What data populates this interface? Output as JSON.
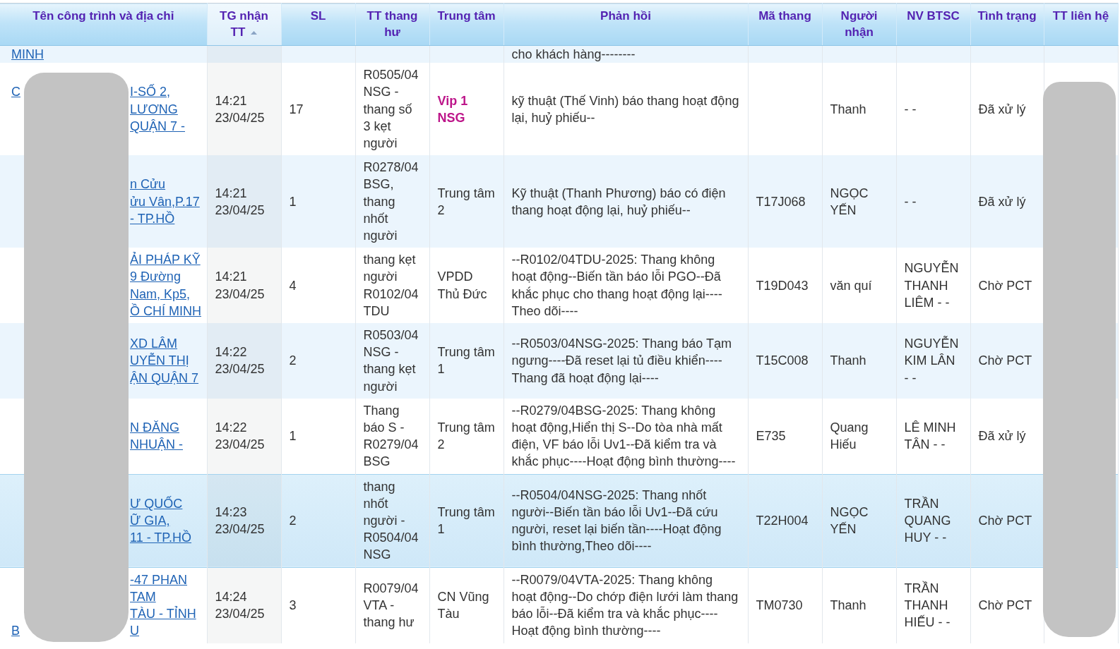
{
  "table": {
    "columns": [
      {
        "label": "Tên công trình và địa chỉ",
        "sorted": false
      },
      {
        "label": "TG nhận TT",
        "sorted": true
      },
      {
        "label": "SL",
        "sorted": false
      },
      {
        "label": "TT thang hư",
        "sorted": false
      },
      {
        "label": "Trung tâm",
        "sorted": false
      },
      {
        "label": "Phản hồi",
        "sorted": false
      },
      {
        "label": "Mã thang",
        "sorted": false
      },
      {
        "label": "Người nhận",
        "sorted": false
      },
      {
        "label": "NV BTSC",
        "sorted": false
      },
      {
        "label": "Tình trạng",
        "sorted": false
      },
      {
        "label": "TT liên hệ",
        "sorted": false
      }
    ],
    "rows": [
      {
        "clipped": true,
        "selected": false,
        "address": [
          {
            "start": "MINH"
          }
        ],
        "feedback": "cho khách hàng--------"
      },
      {
        "clipped": false,
        "selected": false,
        "address": [
          {
            "start": "C",
            "end": "I-SỐ 2,"
          },
          {
            "end": "LƯƠNG"
          },
          {
            "end": "QUẬN 7 -"
          }
        ],
        "time": "14:21 23/04/25",
        "quantity": "17",
        "fault": "R0505/04 NSG - thang số 3 kẹt người",
        "center": {
          "text": "Vip 1 NSG",
          "emphasized": true
        },
        "feedback": "kỹ thuật (Thế Vinh) báo thang hoạt động lại, huỷ phiếu--",
        "receiver": "Thanh",
        "staff": "- -",
        "status": "Đã xử lý"
      },
      {
        "clipped": false,
        "selected": false,
        "address": [
          {
            "end": "n Cửu"
          },
          {
            "end": "ửu Vân,P.17"
          },
          {
            "end": "- TP.HỒ"
          }
        ],
        "time": "14:21 23/04/25",
        "quantity": "1",
        "fault": "R0278/04 BSG, thang nhốt người",
        "center": {
          "text": "Trung tâm 2",
          "emphasized": false
        },
        "feedback": "Kỹ thuật (Thanh Phương) báo có điện thang hoạt động lại, huỷ phiếu--",
        "code": "T17J068",
        "receiver": "NGỌC YẾN",
        "staff": "- -",
        "status": "Đã xử lý"
      },
      {
        "clipped": false,
        "selected": false,
        "address": [
          {
            "end": "ẢI PHÁP KỸ"
          },
          {
            "end": "9 Đường"
          },
          {
            "end": "Nam, Kp5,"
          },
          {
            "end": "Ồ CHÍ MINH"
          }
        ],
        "time": "14:21 23/04/25",
        "quantity": "4",
        "fault": "thang kẹt người R0102/04 TDU",
        "center": {
          "text": "VPDD Thủ Đức",
          "emphasized": false
        },
        "feedback": "--R0102/04TDU-2025: Thang không hoạt động--Biến tần báo lỗi PGO--Đã khắc phục cho thang hoạt động lại----Theo dõi----",
        "code": "T19D043",
        "receiver": "văn quí",
        "staff": "NGUYỄN THANH LIÊM - -",
        "status": "Chờ PCT"
      },
      {
        "clipped": false,
        "selected": false,
        "address": [
          {
            "end": "XD LÂM"
          },
          {
            "end": "UYỄN THỊ"
          },
          {
            "end": "ẬN QUẬN 7"
          }
        ],
        "time": "14:22 23/04/25",
        "quantity": "2",
        "fault": "R0503/04 NSG - thang kẹt người",
        "center": {
          "text": "Trung tâm 1",
          "emphasized": false
        },
        "feedback": "--R0503/04NSG-2025: Thang báo Tạm ngưng----Đã reset lại tủ điều khiển----Thang đã hoạt động lại----",
        "code": "T15C008",
        "receiver": "Thanh",
        "staff": "NGUYỄN KIM LÂN - -",
        "status": "Chờ PCT"
      },
      {
        "clipped": false,
        "selected": false,
        "address": [
          {
            "end": "N ĐĂNG"
          },
          {
            "end": "NHUẬN -"
          }
        ],
        "time": "14:22 23/04/25",
        "quantity": "1",
        "fault": "Thang báo S - R0279/04 BSG",
        "center": {
          "text": "Trung tâm 2",
          "emphasized": false
        },
        "feedback": "--R0279/04BSG-2025: Thang không hoạt động,Hiển thị S--Do tòa nhà mất điện, VF báo lỗi Uv1--Đã kiểm tra và khắc phục----Hoạt động bình thường----",
        "code": "E735",
        "receiver": "Quang Hiếu",
        "staff": "LÊ MINH TÂN - -",
        "status": "Đã xử lý"
      },
      {
        "clipped": false,
        "selected": true,
        "address": [
          {
            "end": "Ư QUỐC"
          },
          {
            "end": "Ữ GIA,"
          },
          {
            "end": "11 - TP.HỒ"
          }
        ],
        "time": "14:23 23/04/25",
        "quantity": "2",
        "fault": "thang nhốt người - R0504/04 NSG",
        "center": {
          "text": "Trung tâm 1",
          "emphasized": false
        },
        "feedback": "--R0504/04NSG-2025: Thang nhốt người--Biến tần báo lỗi Uv1--Đã cứu người, reset lại biến tần----Hoạt động bình thường,Theo dõi----",
        "code": "T22H004",
        "receiver": "NGỌC YẾN",
        "staff": "TRẦN QUANG HUY - -",
        "status": "Chờ PCT"
      },
      {
        "clipped": false,
        "selected": false,
        "address": [
          {
            "end": "-47 PHAN"
          },
          {
            "end": "TAM"
          },
          {
            "end": "TÀU - TỈNH"
          },
          {
            "start": "B",
            "end": "U"
          }
        ],
        "time": "14:24 23/04/25",
        "quantity": "3",
        "fault": "R0079/04 VTA - thang hư",
        "center": {
          "text": "CN Vũng Tàu",
          "emphasized": false
        },
        "feedback": "--R0079/04VTA-2025: Thang không hoạt động--Do chớp điện lưới làm thang báo lỗi--Đã kiểm tra và khắc phục----Hoạt động bình thường----",
        "code": "TM0730",
        "receiver": "Thanh",
        "staff": "TRẦN THANH HIẾU - -",
        "status": "Chờ PCT"
      }
    ]
  }
}
